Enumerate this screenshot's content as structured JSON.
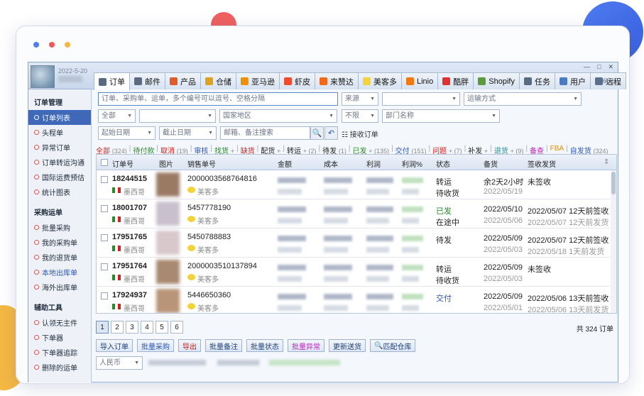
{
  "titlebar": {
    "date": "2022-5-20",
    "version": "H6660",
    "win_min": "—",
    "win_max": "□",
    "win_close": "✕"
  },
  "tabs": [
    {
      "label": "订单",
      "icon": "order-icon",
      "color": "#5a6a80"
    },
    {
      "label": "邮件",
      "icon": "mail-icon",
      "color": "#5a6a80"
    },
    {
      "label": "产品",
      "icon": "product-icon",
      "color": "#e05a2a"
    },
    {
      "label": "仓储",
      "icon": "warehouse-icon",
      "color": "#e0a020"
    },
    {
      "label": "亚马逊",
      "icon": "amazon-icon",
      "color": "#f09000"
    },
    {
      "label": "虾皮",
      "icon": "shopee-icon",
      "color": "#ee4d2d"
    },
    {
      "label": "来赞达",
      "icon": "lazada-icon",
      "color": "#f06a1a"
    },
    {
      "label": "美客多",
      "icon": "mercadolibre-icon",
      "color": "#f3d23a"
    },
    {
      "label": "Linio",
      "icon": "linio-icon",
      "color": "#f07a10"
    },
    {
      "label": "酷胖",
      "icon": "coupang-icon",
      "color": "#e03030"
    },
    {
      "label": "Shopify",
      "icon": "shopify-icon",
      "color": "#5a9a3a"
    },
    {
      "label": "任务",
      "icon": "task-icon",
      "color": "#5a6a80"
    },
    {
      "label": "用户",
      "icon": "user-icon",
      "color": "#4a7ac0"
    },
    {
      "label": "远程",
      "icon": "remote-icon",
      "color": "#5a7090"
    }
  ],
  "sidebar": {
    "groups": [
      {
        "title": "订单管理",
        "items": [
          "订单列表",
          "头程单",
          "异常订单",
          "订单转运沟通",
          "国际运费预估",
          "统计图表"
        ]
      },
      {
        "title": "采购运单",
        "items": [
          "批量采购",
          "我的采购单",
          "我的退货单",
          "本地出库单",
          "海外出库单"
        ]
      },
      {
        "title": "辅助工具",
        "items": [
          "认领无主件",
          "下单器",
          "下单器追踪",
          "删除的运单"
        ]
      }
    ]
  },
  "filters": {
    "search_placeholder": "订单、采购单、运单，多个编号可以逗号、空格分隔",
    "source": "来源",
    "transport": "运输方式",
    "all": "全部",
    "region": "国家地区",
    "limit": "不限",
    "department": "部门名称",
    "start_date": "起始日期",
    "end_date": "截止日期",
    "remark_placeholder": "邮箱、备注搜索",
    "receive_link": "接收订单"
  },
  "status_bar": [
    {
      "label": "全部",
      "count": "(324)",
      "color": "#d02020"
    },
    {
      "label": "待付款",
      "count": "",
      "color": "#2a8a2a"
    },
    {
      "label": "取消",
      "count": "(19)",
      "color": "#d02020"
    },
    {
      "label": "审核",
      "count": "",
      "color": "#2a56b8"
    },
    {
      "label": "找货",
      "count": "+",
      "color": "#2a8a2a"
    },
    {
      "label": "缺货",
      "count": "",
      "color": "#d02020"
    },
    {
      "label": "配货",
      "count": "+",
      "color": "#222"
    },
    {
      "label": "转运",
      "count": "+ (2)",
      "color": "#222"
    },
    {
      "label": "待发",
      "count": "(1)",
      "color": "#222"
    },
    {
      "label": "已发",
      "count": "+ (135)",
      "color": "#2a8a2a"
    },
    {
      "label": "交付",
      "count": "(151)",
      "color": "#2a56b8"
    },
    {
      "label": "问题",
      "count": "+ (7)",
      "color": "#d02020"
    },
    {
      "label": "补发",
      "count": "+",
      "color": "#222"
    },
    {
      "label": "退货",
      "count": "+ (9)",
      "color": "#2a8a9a"
    },
    {
      "label": "备查",
      "count": "",
      "color": "#c020c0"
    },
    {
      "label": "FBA",
      "count": "",
      "color": "#e08a00"
    },
    {
      "label": "自发货",
      "count": "(324)",
      "color": "#2a56b8"
    }
  ],
  "columns": [
    "订单号",
    "图片",
    "销售单号",
    "金额",
    "成本",
    "利润",
    "利润%",
    "状态",
    "备货",
    "签收发货"
  ],
  "rows": [
    {
      "order_no": "18244515",
      "country": "墨西哥",
      "sale_no": "2000003568764816",
      "shop": "美客多",
      "status1": "转运",
      "status2": "待收货",
      "stock1": "余2天2小时",
      "stock2": "2022/05/19",
      "sign1": "未签收",
      "sign2": "",
      "status1_color": "#222",
      "thumb": "#9a7a64"
    },
    {
      "order_no": "18001707",
      "country": "墨西哥",
      "sale_no": "5457778190",
      "shop": "美客多",
      "status1": "已发",
      "status2": "在途中",
      "stock1": "2022/05/10",
      "stock2": "2022/05/06",
      "sign1": "2022/05/07 12天前签收",
      "sign2": "2022/05/07 12天前发货",
      "status1_color": "#2a8a2a",
      "thumb": "#c8c0cc"
    },
    {
      "order_no": "17951765",
      "country": "墨西哥",
      "sale_no": "5450788883",
      "shop": "美客多",
      "status1": "待发",
      "status2": "",
      "stock1": "2022/05/09",
      "stock2": "2022/05/03",
      "sign1": "2022/05/07 12天前签收",
      "sign2": "2022/05/18 1天前发货",
      "status1_color": "#222",
      "thumb": "#d8c8cc"
    },
    {
      "order_no": "17951764",
      "country": "墨西哥",
      "sale_no": "2000003510137894",
      "shop": "美客多",
      "status1": "转运",
      "status2": "待收货",
      "stock1": "2022/05/09",
      "stock2": "2022/05/03",
      "sign1": "未签收",
      "sign2": "",
      "status1_color": "#222",
      "thumb": "#a88a70"
    },
    {
      "order_no": "17924937",
      "country": "墨西哥",
      "sale_no": "5446650360",
      "shop": "美客多",
      "status1": "交付",
      "status2": "",
      "stock1": "2022/05/09",
      "stock2": "2022/05/01",
      "sign1": "2022/05/06 13天前签收",
      "sign2": "2022/05/06 13天前发货",
      "status1_color": "#2a56b8",
      "thumb": "#b89478"
    }
  ],
  "pager": {
    "pages": [
      "1",
      "2",
      "3",
      "4",
      "5",
      "6"
    ],
    "total": "共 324 订单"
  },
  "actions": [
    {
      "label": "导入订单",
      "color": "#1f3f7a"
    },
    {
      "label": "批量采购",
      "color": "#2a56b8"
    },
    {
      "label": "导出",
      "color": "#c02020"
    },
    {
      "label": "批量备注",
      "color": "#1f3f7a"
    },
    {
      "label": "批量状态",
      "color": "#1f3f7a"
    },
    {
      "label": "批量异常",
      "color": "#c020c0"
    },
    {
      "label": "更新送货",
      "color": "#1f3f7a"
    },
    {
      "label": "匹配仓库",
      "color": "#1f3f7a"
    }
  ],
  "currency": "人民币"
}
